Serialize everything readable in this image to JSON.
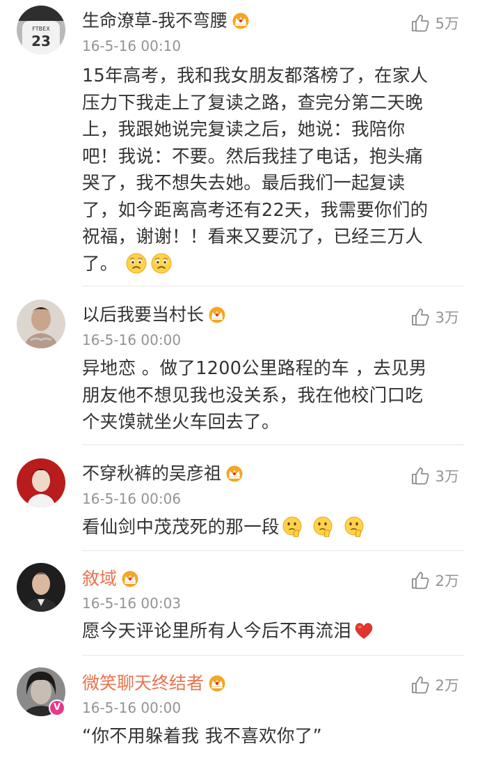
{
  "comments": [
    {
      "username": "生命潦草-我不弯腰",
      "timestamp": "16-5-16 00:10",
      "likes": "5万",
      "body_lines": [
        "15年高考，我和我女朋友都落榜了，在家人",
        "压力下我走上了复读之路，查完分第二天晚",
        "上，我跟她说完复读之后，她说：我陪你",
        "吧！我说：不要。然后我挂了电话，抱头痛",
        "哭了，我不想失去她。最后我们一起复读",
        "了，如今距离高考还有22天，我需要你们的",
        "祝福，谢谢！！看来又要沉了，已经三万人",
        "了。"
      ],
      "avatar_text": "23"
    },
    {
      "username": "以后我要当村长",
      "timestamp": "16-5-16 00:00",
      "likes": "3万",
      "body_lines": [
        "异地恋 。做了1200公里路程的车 ，去见男",
        "朋友他不想见我也没关系，我在他校门口吃",
        "个夹馍就坐火车回去了。"
      ]
    },
    {
      "username": "不穿秋裤的吴彦祖",
      "timestamp": "16-5-16 00:06",
      "likes": "3万",
      "body_lines": [
        "看仙剑中茂茂死的那一段"
      ]
    },
    {
      "username": "敘域",
      "timestamp": "16-5-16 00:03",
      "likes": "2万",
      "body_lines": [
        "愿今天评论里所有人今后不再流泪"
      ]
    },
    {
      "username": "微笑聊天终结者",
      "timestamp": "16-5-16 00:00",
      "likes": "2万",
      "body_lines": [
        "“你不用躲着我 我不喜欢你了”"
      ],
      "badge": "V"
    }
  ],
  "colors": {
    "username": "#333333",
    "username_highlight": "#eb7350",
    "meta": "#939393",
    "divider": "#e6e6e6"
  }
}
